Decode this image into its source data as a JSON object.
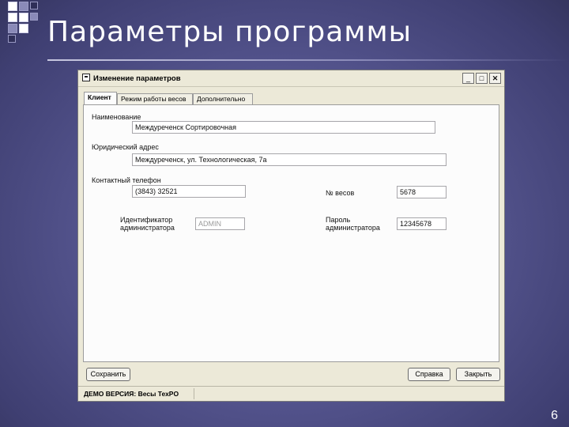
{
  "slide": {
    "title": "Параметры программы",
    "page_number": "6"
  },
  "window": {
    "title": "Изменение параметров",
    "controls": {
      "minimize": "_",
      "maximize": "□",
      "close": "✕"
    }
  },
  "tabs": [
    {
      "label": "Клиент",
      "active": true
    },
    {
      "label": "Режим работы весов",
      "active": false
    },
    {
      "label": "Дополнительно",
      "active": false
    }
  ],
  "form": {
    "name": {
      "label": "Наименование",
      "value": "Междуреченск Сортировочная"
    },
    "legal_address": {
      "label": "Юридический адрес",
      "value": "Междуреченск, ул. Технологическая, 7а"
    },
    "phone": {
      "label": "Контактный телефон",
      "value": "(3843) 32521"
    },
    "scale_number": {
      "label": "№ весов",
      "value": "5678"
    },
    "admin_id": {
      "label_line1": "Идентификатор",
      "label_line2": "администратора",
      "value": "ADMIN"
    },
    "admin_password": {
      "label_line1": "Пароль",
      "label_line2": "администратора",
      "value": "12345678"
    }
  },
  "buttons": {
    "save": "Сохранить",
    "help": "Справка",
    "close": "Закрыть"
  },
  "status_bar": {
    "text": "ДЕМО ВЕРСИЯ: Весы ТехPO"
  }
}
